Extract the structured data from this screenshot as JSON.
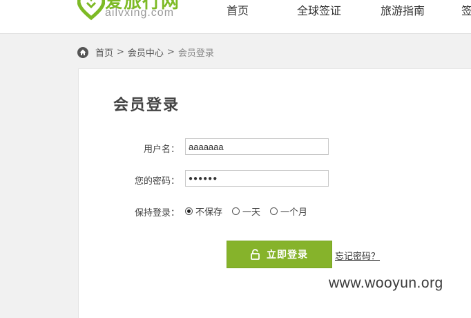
{
  "header": {
    "logo_text": "爱旅行网",
    "logo_sub": "ailvxing.com",
    "nav": [
      "首页",
      "全球签证",
      "旅游指南",
      "签"
    ]
  },
  "breadcrumb": {
    "home": "首页",
    "sep": ">",
    "member_center": "会员中心",
    "current": "会员登录"
  },
  "login": {
    "title": "会员登录",
    "username_label": "用户名：",
    "username_value": "aaaaaaa",
    "password_label": "您的密码：",
    "password_value": "●●●●●●",
    "keep_label": "保持登录：",
    "keep_options": [
      "不保存",
      "一天",
      "一个月"
    ],
    "keep_selected": "不保存",
    "submit_label": "立即登录",
    "forgot_label": "忘记密码？"
  },
  "watermark": "www.wooyun.org",
  "colors": {
    "brand_green": "#7dba25",
    "button_green": "#86b32b"
  }
}
